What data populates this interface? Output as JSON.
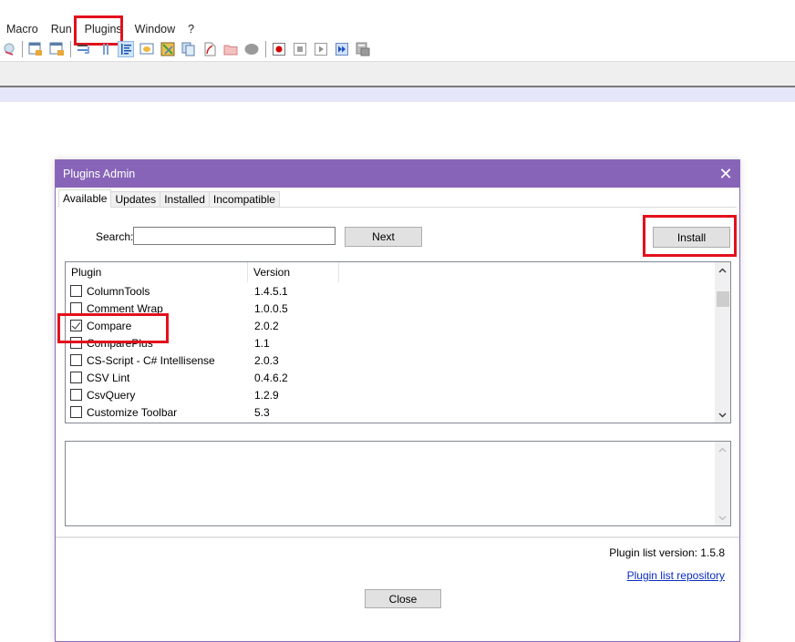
{
  "menubar": {
    "items": [
      "Macro",
      "Run",
      "Plugins",
      "Window",
      "?"
    ],
    "highlighted": "Plugins"
  },
  "toolbar": {
    "icons": [
      "zoom-search-icon",
      "separator",
      "lock-window-icon",
      "lock-window-alt-icon",
      "separator",
      "word-wrap-icon",
      "show-all-chars-icon",
      "indent-guide-icon",
      "doc-map-icon",
      "function-list-icon",
      "clone-docs-icon",
      "pdf-document-icon",
      "folder-icon",
      "monitoring-icon",
      "separator",
      "record-macro-icon",
      "stop-macro-icon",
      "play-macro-icon",
      "run-macro-multiple-icon",
      "save-macro-icon"
    ]
  },
  "dialog": {
    "title": "Plugins Admin",
    "close_glyph": "✕",
    "tabs": [
      {
        "label": "Available",
        "active": true
      },
      {
        "label": "Updates",
        "active": false
      },
      {
        "label": "Installed",
        "active": false
      },
      {
        "label": "Incompatible",
        "active": false
      }
    ],
    "search": {
      "label": "Search:",
      "value": "",
      "placeholder": ""
    },
    "next_label": "Next",
    "install_label": "Install",
    "list": {
      "columns": [
        "Plugin",
        "Version"
      ],
      "rows": [
        {
          "name": "ColumnTools",
          "version": "1.4.5.1",
          "checked": false
        },
        {
          "name": "Comment Wrap",
          "version": "1.0.0.5",
          "checked": false
        },
        {
          "name": "Compare",
          "version": "2.0.2",
          "checked": true
        },
        {
          "name": "ComparePlus",
          "version": "1.1",
          "checked": false
        },
        {
          "name": "CS-Script - C# Intellisense",
          "version": "2.0.3",
          "checked": false
        },
        {
          "name": "CSV Lint",
          "version": "0.4.6.2",
          "checked": false
        },
        {
          "name": "CsvQuery",
          "version": "1.2.9",
          "checked": false
        },
        {
          "name": "Customize Toolbar",
          "version": "5.3",
          "checked": false
        }
      ]
    },
    "description": "",
    "plugin_list_version_label": "Plugin list version:  1.5.8",
    "repo_link": "Plugin list repository",
    "close_label": "Close"
  },
  "colors": {
    "title_bar": "#8764b8",
    "highlight_red": "#e3101c",
    "editor_line": "#e6e6fa",
    "link": "#0a2dc4"
  }
}
